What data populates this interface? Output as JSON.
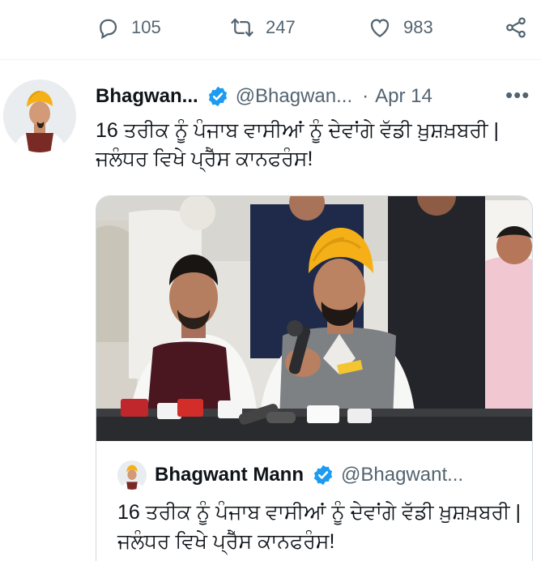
{
  "actions": {
    "replies": "105",
    "retweets": "247",
    "likes": "983"
  },
  "tweet": {
    "author_name": "Bhagwan...",
    "author_handle": "@Bhagwan...",
    "separator": "·",
    "date": "Apr 14",
    "more": "•••",
    "text": "16 ਤਰੀਕ ਨੂੰ ਪੰਜਾਬ ਵਾਸੀਆਂ ਨੂੰ ਦੇਵਾਂਗੇ ਵੱਡੀ ਖ਼ੁਸ਼ਖ਼ਬਰੀ | ਜਲੰਧਰ ਵਿਖੇ ਪ੍ਰੈੱਸ ਕਾਨਫਰੰਸ!"
  },
  "quote": {
    "author_name": "Bhagwant Mann",
    "author_handle": "@Bhagwant...",
    "text": "16 ਤਰੀਕ ਨੂੰ ਪੰਜਾਬ ਵਾਸੀਆਂ ਨੂੰ ਦੇਵਾਂਗੇ ਵੱਡੀ ਖ਼ੁਸ਼ਖ਼ਬਰੀ | ਜਲੰਧਰ ਵਿਖੇ ਪ੍ਰੈੱਸ ਕਾਨਫਰੰਸ!"
  },
  "icons": {
    "reply": "reply-icon",
    "retweet": "retweet-icon",
    "like": "like-icon",
    "share": "share-icon",
    "verified": "verified-badge-icon",
    "more": "more-options-icon"
  },
  "colors": {
    "text_primary": "#0f1419",
    "text_secondary": "#536471",
    "verified_blue": "#1d9bf0",
    "border": "#cfd9de",
    "turban": "#f6b017"
  }
}
